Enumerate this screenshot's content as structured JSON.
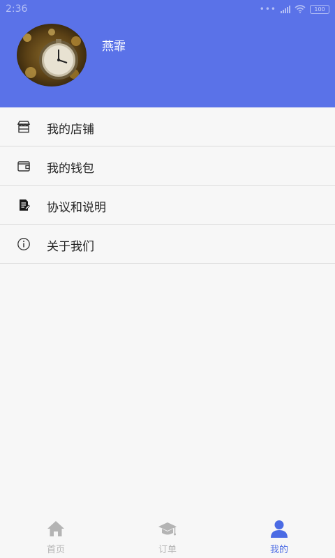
{
  "status_bar": {
    "time": "2:36",
    "battery": "100"
  },
  "profile": {
    "username": "燕霏"
  },
  "menu": {
    "items": [
      {
        "label": "我的店铺",
        "icon": "store-icon"
      },
      {
        "label": "我的钱包",
        "icon": "wallet-icon"
      },
      {
        "label": "协议和说明",
        "icon": "document-icon"
      },
      {
        "label": "关于我们",
        "icon": "info-icon"
      }
    ]
  },
  "tabbar": {
    "tabs": [
      {
        "label": "首页",
        "icon": "home-icon"
      },
      {
        "label": "订单",
        "icon": "graduation-cap-icon"
      },
      {
        "label": "我的",
        "icon": "user-icon"
      }
    ],
    "active_index": 2
  },
  "colors": {
    "header": "#5a72e8",
    "accent": "#4b6be4",
    "inactive": "#b4b4b4"
  }
}
